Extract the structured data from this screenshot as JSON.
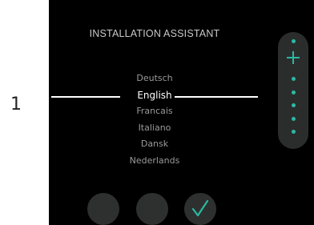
{
  "callout": {
    "number": "1"
  },
  "screen": {
    "title": "INSTALLATION ASSISTANT",
    "languages": [
      "Deutsch",
      "English",
      "Francais",
      "Italiano",
      "Dansk",
      "Nederlands"
    ],
    "selected_language": "English"
  },
  "side_panel": {
    "icons": [
      "dot",
      "plus-icon",
      "dot",
      "dot",
      "dot",
      "dot",
      "dot"
    ]
  },
  "buttons": [
    {
      "name": "unlabeled-button-1"
    },
    {
      "name": "unlabeled-button-2"
    },
    {
      "name": "confirm-button",
      "icon": "check-icon"
    }
  ],
  "colors": {
    "accent": "#2bb8a2",
    "background": "#000000",
    "panel": "#2b2d2d"
  }
}
